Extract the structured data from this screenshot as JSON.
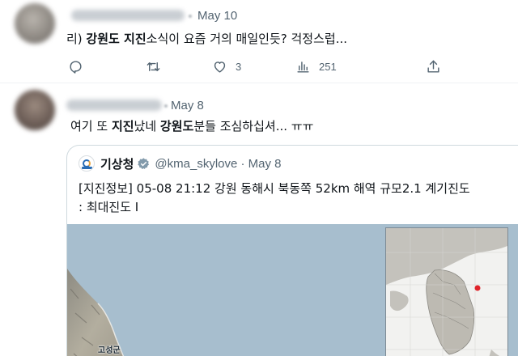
{
  "tweets": [
    {
      "date": "May 10",
      "text_pre": "리) ",
      "text_bold1": "강원도 지진",
      "text_post": "소식이 요즘 거의 매일인듯? 걱정스럽...",
      "actions": {
        "reply_count": "",
        "retweet_count": "",
        "like_count": "3",
        "view_count": "251"
      }
    },
    {
      "date": "May 8",
      "text_pre": "여기 또 ",
      "text_bold1": "지진",
      "text_mid": "났네 ",
      "text_bold2": "강원도",
      "text_post": "분들 조심하십셔... ㅠㅠ",
      "quote": {
        "name": "기상청",
        "handle_date": "@kma_skylove · May 8",
        "line1": "[지진정보] 05-08 21:12 강원 동해시 북동쪽 52km 해역 규모2.1 계기진도",
        "line2": ": 최대진도 Ⅰ",
        "map_label": "고성군"
      }
    }
  ],
  "colors": {
    "text": "#0f1419",
    "secondary": "#536471",
    "verified": "#829aab",
    "epicenter": "#e0242b"
  },
  "icons": [
    "reply-icon",
    "retweet-icon",
    "like-icon",
    "views-icon",
    "share-icon",
    "verified-badge-icon"
  ]
}
